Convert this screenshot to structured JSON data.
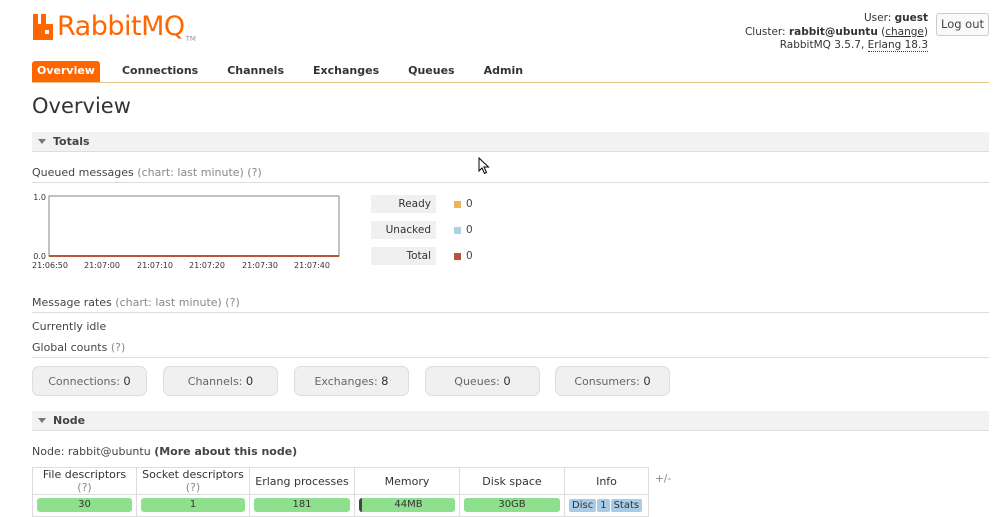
{
  "header": {
    "logo_text": "RabbitMQ",
    "logo_tm": "TM",
    "user_label": "User:",
    "user_name": "guest",
    "cluster_label": "Cluster:",
    "cluster_name": "rabbit@ubuntu",
    "change_link": "change",
    "version": "RabbitMQ 3.5.7,",
    "erlang": "Erlang 18.3",
    "logout_label": "Log out"
  },
  "tabs": [
    {
      "label": "Overview",
      "active": true
    },
    {
      "label": "Connections"
    },
    {
      "label": "Channels"
    },
    {
      "label": "Exchanges"
    },
    {
      "label": "Queues"
    },
    {
      "label": "Admin"
    }
  ],
  "page_title": "Overview",
  "totals": {
    "section_label": "Totals",
    "queued_label": "Queued messages",
    "queued_hint": "(chart: last minute) (?)",
    "chart": {
      "y_ticks": [
        "1.0",
        "0.0"
      ],
      "x_ticks": [
        "21:06:50",
        "21:07:00",
        "21:07:10",
        "21:07:20",
        "21:07:30",
        "21:07:40"
      ]
    },
    "legend": [
      {
        "label": "Ready",
        "value": "0",
        "color": "#edb45f"
      },
      {
        "label": "Unacked",
        "value": "0",
        "color": "#a8d4e6"
      },
      {
        "label": "Total",
        "value": "0",
        "color": "#b5553a"
      }
    ],
    "rates_label": "Message rates",
    "rates_hint": "(chart: last minute) (?)",
    "idle_text": "Currently idle",
    "global_label": "Global counts",
    "global_hint": "(?)",
    "counts": [
      {
        "label": "Connections:",
        "value": "0"
      },
      {
        "label": "Channels:",
        "value": "0"
      },
      {
        "label": "Exchanges:",
        "value": "8"
      },
      {
        "label": "Queues:",
        "value": "0"
      },
      {
        "label": "Consumers:",
        "value": "0"
      }
    ]
  },
  "node": {
    "section_label": "Node",
    "node_prefix": "Node: rabbit@ubuntu",
    "more_link": "(More about this node)",
    "columns": [
      {
        "label": "File descriptors",
        "hint": "(?)"
      },
      {
        "label": "Socket descriptors",
        "hint": "(?)"
      },
      {
        "label": "Erlang processes",
        "hint": ""
      },
      {
        "label": "Memory",
        "hint": ""
      },
      {
        "label": "Disk space",
        "hint": ""
      },
      {
        "label": "Info",
        "hint": ""
      }
    ],
    "values": {
      "file_descriptors": "30",
      "socket_descriptors": "1",
      "erlang_processes": "181",
      "memory": "44MB",
      "disk_space": "30GB",
      "info_badges": [
        "Disc",
        "1",
        "Stats"
      ]
    },
    "plus_minus": "+/-"
  }
}
